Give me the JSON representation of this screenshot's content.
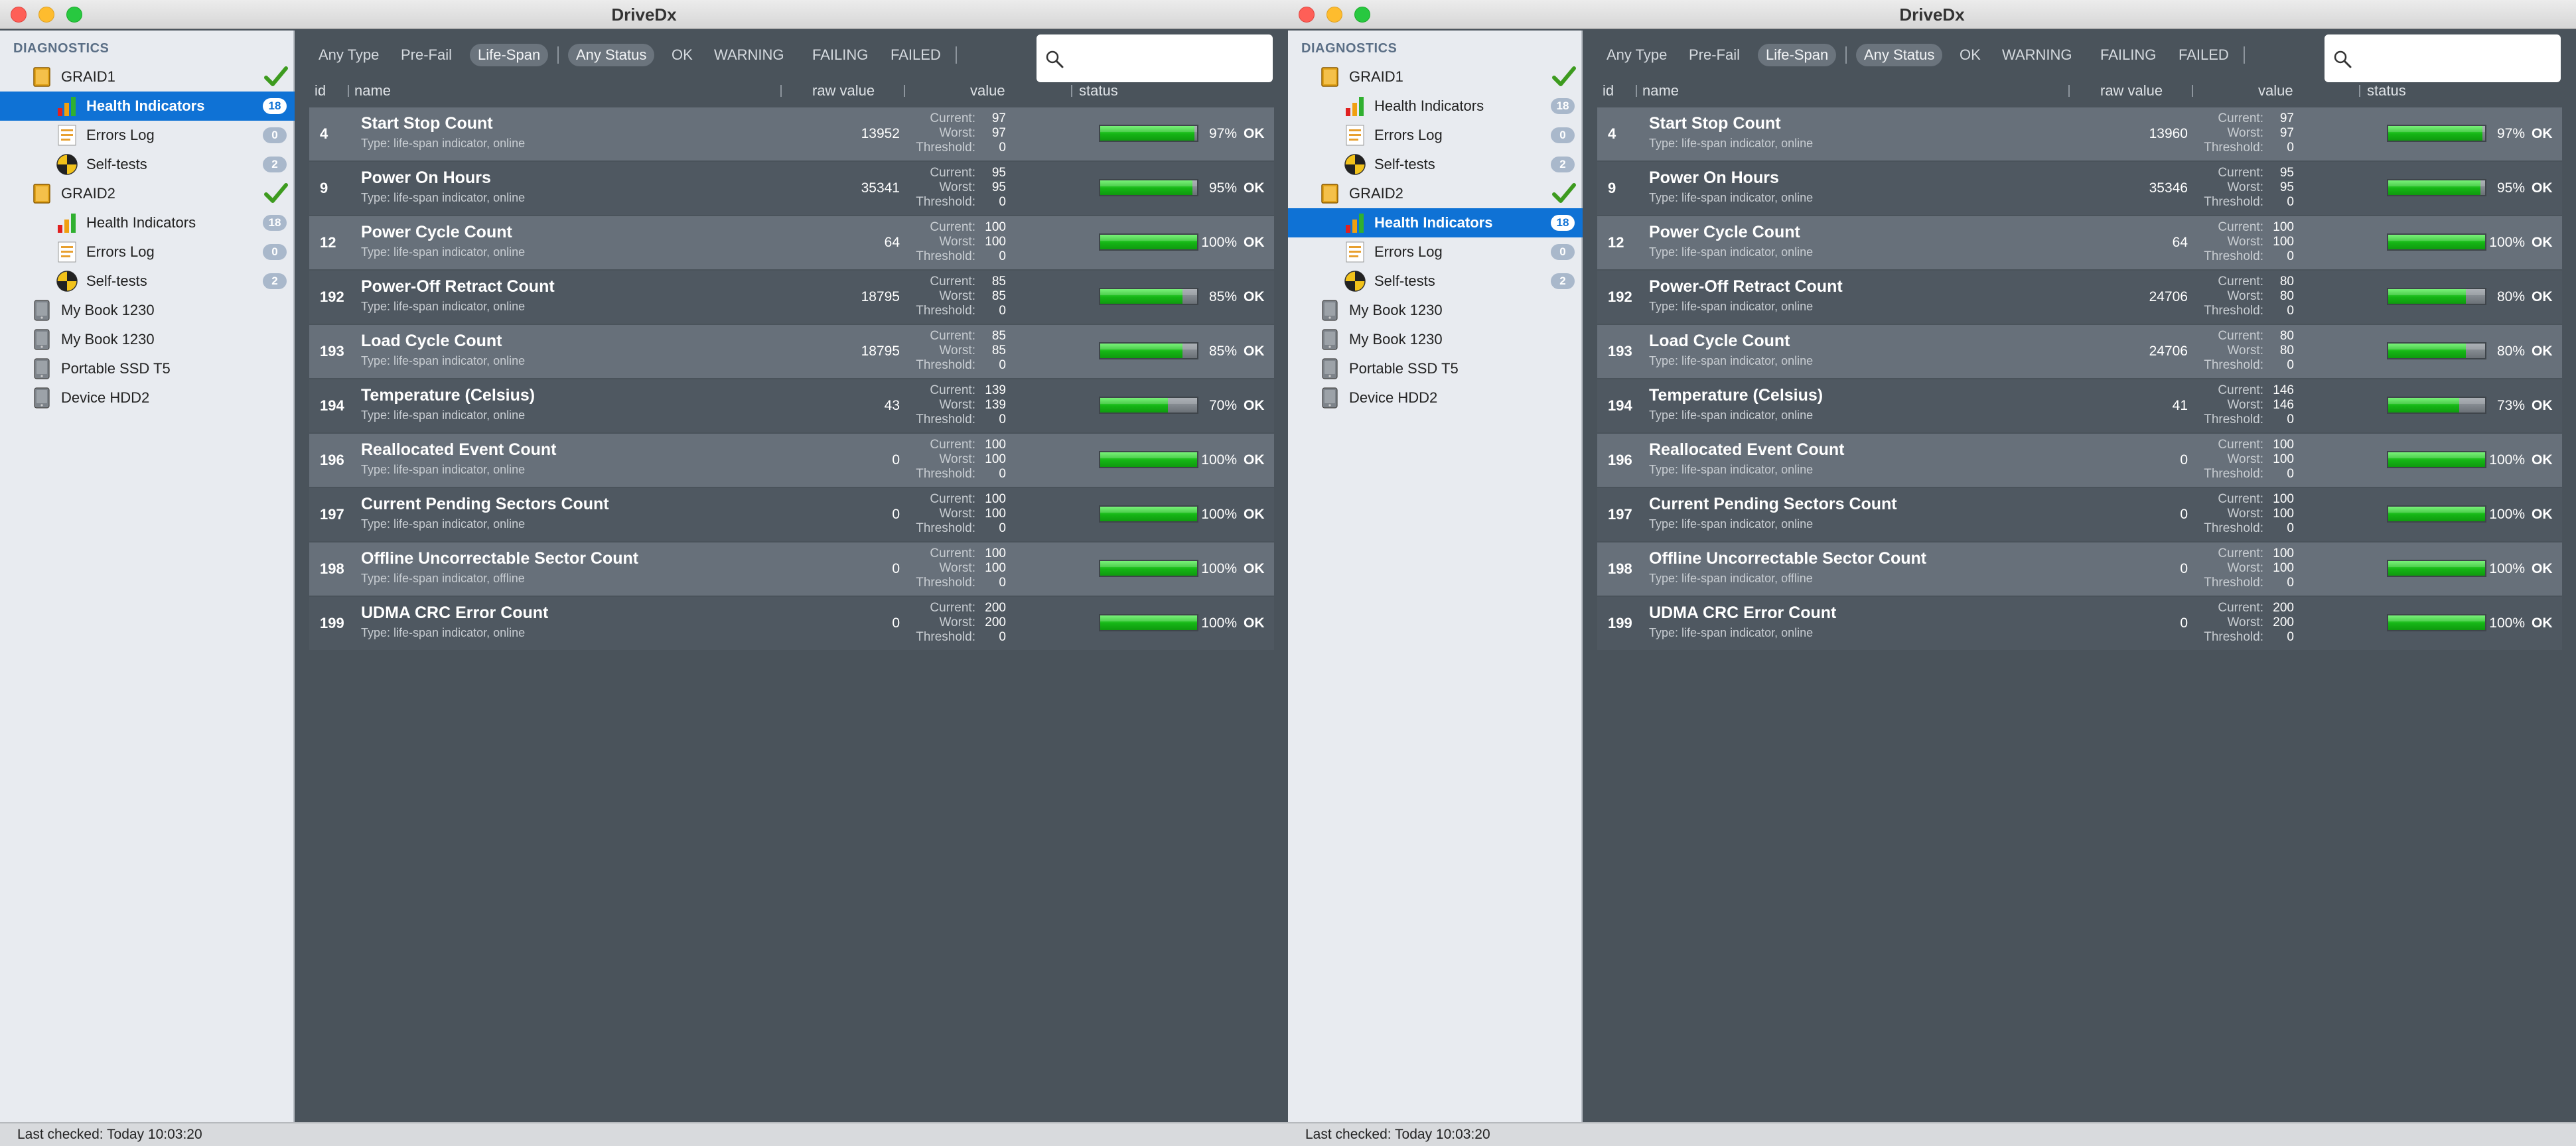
{
  "windows": [
    {
      "title": "DriveDx",
      "sidebar": {
        "header": "DIAGNOSTICS",
        "items": [
          {
            "label": "GRAID1",
            "kind": "raid",
            "level": 0,
            "checked": true,
            "badge": null,
            "selected": false
          },
          {
            "label": "Health Indicators",
            "kind": "health",
            "level": 1,
            "badge": "18",
            "selected": true
          },
          {
            "label": "Errors Log",
            "kind": "log",
            "level": 1,
            "badge": "0",
            "selected": false
          },
          {
            "label": "Self-tests",
            "kind": "selftest",
            "level": 1,
            "badge": "2",
            "selected": false
          },
          {
            "label": "GRAID2",
            "kind": "raid",
            "level": 0,
            "checked": true,
            "badge": null,
            "selected": false
          },
          {
            "label": "Health Indicators",
            "kind": "health",
            "level": 1,
            "badge": "18",
            "selected": false
          },
          {
            "label": "Errors Log",
            "kind": "log",
            "level": 1,
            "badge": "0",
            "selected": false
          },
          {
            "label": "Self-tests",
            "kind": "selftest",
            "level": 1,
            "badge": "2",
            "selected": false
          },
          {
            "label": "My Book 1230",
            "kind": "disk",
            "level": 0,
            "badge": null,
            "selected": false
          },
          {
            "label": "My Book 1230",
            "kind": "disk",
            "level": 0,
            "badge": null,
            "selected": false
          },
          {
            "label": "Portable SSD T5",
            "kind": "disk",
            "level": 0,
            "badge": null,
            "selected": false
          },
          {
            "label": "Device HDD2",
            "kind": "disk",
            "level": 0,
            "badge": null,
            "selected": false
          }
        ]
      },
      "filters": {
        "type": [
          "Any Type",
          "Pre-Fail",
          "Life-Span"
        ],
        "type_selected": "Life-Span",
        "status": [
          "Any Status",
          "OK",
          "WARNING",
          "FAILING",
          "FAILED"
        ],
        "status_selected": "Any Status"
      },
      "search": {
        "placeholder": ""
      },
      "columns": {
        "id": "id",
        "name": "name",
        "raw": "raw value",
        "value": "value",
        "status": "status"
      },
      "value_labels": {
        "current": "Current:",
        "worst": "Worst:",
        "threshold": "Threshold:"
      },
      "rows": [
        {
          "id": "4",
          "name": "Start Stop Count",
          "type": "Type: life-span indicator, online",
          "raw": "13952",
          "current": "97",
          "worst": "97",
          "threshold": "0",
          "pct": 97,
          "pct_label": "97%",
          "status": "OK"
        },
        {
          "id": "9",
          "name": "Power On Hours",
          "type": "Type: life-span indicator, online",
          "raw": "35341",
          "current": "95",
          "worst": "95",
          "threshold": "0",
          "pct": 95,
          "pct_label": "95%",
          "status": "OK"
        },
        {
          "id": "12",
          "name": "Power Cycle Count",
          "type": "Type: life-span indicator, online",
          "raw": "64",
          "current": "100",
          "worst": "100",
          "threshold": "0",
          "pct": 100,
          "pct_label": "100%",
          "status": "OK"
        },
        {
          "id": "192",
          "name": "Power-Off Retract Count",
          "type": "Type: life-span indicator, online",
          "raw": "18795",
          "current": "85",
          "worst": "85",
          "threshold": "0",
          "pct": 85,
          "pct_label": "85%",
          "status": "OK"
        },
        {
          "id": "193",
          "name": "Load Cycle Count",
          "type": "Type: life-span indicator, online",
          "raw": "18795",
          "current": "85",
          "worst": "85",
          "threshold": "0",
          "pct": 85,
          "pct_label": "85%",
          "status": "OK"
        },
        {
          "id": "194",
          "name": "Temperature (Celsius)",
          "type": "Type: life-span indicator, online",
          "raw": "43",
          "current": "139",
          "worst": "139",
          "threshold": "0",
          "pct": 70,
          "pct_label": "70%",
          "status": "OK"
        },
        {
          "id": "196",
          "name": "Reallocated Event Count",
          "type": "Type: life-span indicator, online",
          "raw": "0",
          "current": "100",
          "worst": "100",
          "threshold": "0",
          "pct": 100,
          "pct_label": "100%",
          "status": "OK"
        },
        {
          "id": "197",
          "name": "Current Pending Sectors Count",
          "type": "Type: life-span indicator, online",
          "raw": "0",
          "current": "100",
          "worst": "100",
          "threshold": "0",
          "pct": 100,
          "pct_label": "100%",
          "status": "OK"
        },
        {
          "id": "198",
          "name": "Offline Uncorrectable Sector Count",
          "type": "Type: life-span indicator, offline",
          "raw": "0",
          "current": "100",
          "worst": "100",
          "threshold": "0",
          "pct": 100,
          "pct_label": "100%",
          "status": "OK"
        },
        {
          "id": "199",
          "name": "UDMA CRC Error Count",
          "type": "Type: life-span indicator, online",
          "raw": "0",
          "current": "200",
          "worst": "200",
          "threshold": "0",
          "pct": 100,
          "pct_label": "100%",
          "status": "OK"
        }
      ],
      "statusbar": "Last checked: Today 10:03:20"
    },
    {
      "title": "DriveDx",
      "sidebar": {
        "header": "DIAGNOSTICS",
        "items": [
          {
            "label": "GRAID1",
            "kind": "raid",
            "level": 0,
            "checked": true,
            "badge": null,
            "selected": false
          },
          {
            "label": "Health Indicators",
            "kind": "health",
            "level": 1,
            "badge": "18",
            "selected": false
          },
          {
            "label": "Errors Log",
            "kind": "log",
            "level": 1,
            "badge": "0",
            "selected": false
          },
          {
            "label": "Self-tests",
            "kind": "selftest",
            "level": 1,
            "badge": "2",
            "selected": false
          },
          {
            "label": "GRAID2",
            "kind": "raid",
            "level": 0,
            "checked": true,
            "badge": null,
            "selected": false
          },
          {
            "label": "Health Indicators",
            "kind": "health",
            "level": 1,
            "badge": "18",
            "selected": true
          },
          {
            "label": "Errors Log",
            "kind": "log",
            "level": 1,
            "badge": "0",
            "selected": false
          },
          {
            "label": "Self-tests",
            "kind": "selftest",
            "level": 1,
            "badge": "2",
            "selected": false
          },
          {
            "label": "My Book 1230",
            "kind": "disk",
            "level": 0,
            "badge": null,
            "selected": false
          },
          {
            "label": "My Book 1230",
            "kind": "disk",
            "level": 0,
            "badge": null,
            "selected": false
          },
          {
            "label": "Portable SSD T5",
            "kind": "disk",
            "level": 0,
            "badge": null,
            "selected": false
          },
          {
            "label": "Device HDD2",
            "kind": "disk",
            "level": 0,
            "badge": null,
            "selected": false
          }
        ]
      },
      "filters": {
        "type": [
          "Any Type",
          "Pre-Fail",
          "Life-Span"
        ],
        "type_selected": "Life-Span",
        "status": [
          "Any Status",
          "OK",
          "WARNING",
          "FAILING",
          "FAILED"
        ],
        "status_selected": "Any Status"
      },
      "search": {
        "placeholder": ""
      },
      "columns": {
        "id": "id",
        "name": "name",
        "raw": "raw value",
        "value": "value",
        "status": "status"
      },
      "value_labels": {
        "current": "Current:",
        "worst": "Worst:",
        "threshold": "Threshold:"
      },
      "rows": [
        {
          "id": "4",
          "name": "Start Stop Count",
          "type": "Type: life-span indicator, online",
          "raw": "13960",
          "current": "97",
          "worst": "97",
          "threshold": "0",
          "pct": 97,
          "pct_label": "97%",
          "status": "OK"
        },
        {
          "id": "9",
          "name": "Power On Hours",
          "type": "Type: life-span indicator, online",
          "raw": "35346",
          "current": "95",
          "worst": "95",
          "threshold": "0",
          "pct": 95,
          "pct_label": "95%",
          "status": "OK"
        },
        {
          "id": "12",
          "name": "Power Cycle Count",
          "type": "Type: life-span indicator, online",
          "raw": "64",
          "current": "100",
          "worst": "100",
          "threshold": "0",
          "pct": 100,
          "pct_label": "100%",
          "status": "OK"
        },
        {
          "id": "192",
          "name": "Power-Off Retract Count",
          "type": "Type: life-span indicator, online",
          "raw": "24706",
          "current": "80",
          "worst": "80",
          "threshold": "0",
          "pct": 80,
          "pct_label": "80%",
          "status": "OK"
        },
        {
          "id": "193",
          "name": "Load Cycle Count",
          "type": "Type: life-span indicator, online",
          "raw": "24706",
          "current": "80",
          "worst": "80",
          "threshold": "0",
          "pct": 80,
          "pct_label": "80%",
          "status": "OK"
        },
        {
          "id": "194",
          "name": "Temperature (Celsius)",
          "type": "Type: life-span indicator, online",
          "raw": "41",
          "current": "146",
          "worst": "146",
          "threshold": "0",
          "pct": 73,
          "pct_label": "73%",
          "status": "OK"
        },
        {
          "id": "196",
          "name": "Reallocated Event Count",
          "type": "Type: life-span indicator, online",
          "raw": "0",
          "current": "100",
          "worst": "100",
          "threshold": "0",
          "pct": 100,
          "pct_label": "100%",
          "status": "OK"
        },
        {
          "id": "197",
          "name": "Current Pending Sectors Count",
          "type": "Type: life-span indicator, online",
          "raw": "0",
          "current": "100",
          "worst": "100",
          "threshold": "0",
          "pct": 100,
          "pct_label": "100%",
          "status": "OK"
        },
        {
          "id": "198",
          "name": "Offline Uncorrectable Sector Count",
          "type": "Type: life-span indicator, offline",
          "raw": "0",
          "current": "100",
          "worst": "100",
          "threshold": "0",
          "pct": 100,
          "pct_label": "100%",
          "status": "OK"
        },
        {
          "id": "199",
          "name": "UDMA CRC Error Count",
          "type": "Type: life-span indicator, online",
          "raw": "0",
          "current": "200",
          "worst": "200",
          "threshold": "0",
          "pct": 100,
          "pct_label": "100%",
          "status": "OK"
        }
      ],
      "statusbar": "Last checked: Today 10:03:20"
    }
  ],
  "colors": {
    "selection": "#0f72d5",
    "ok_green": "#15b515",
    "content_bg": "#4a535b"
  }
}
